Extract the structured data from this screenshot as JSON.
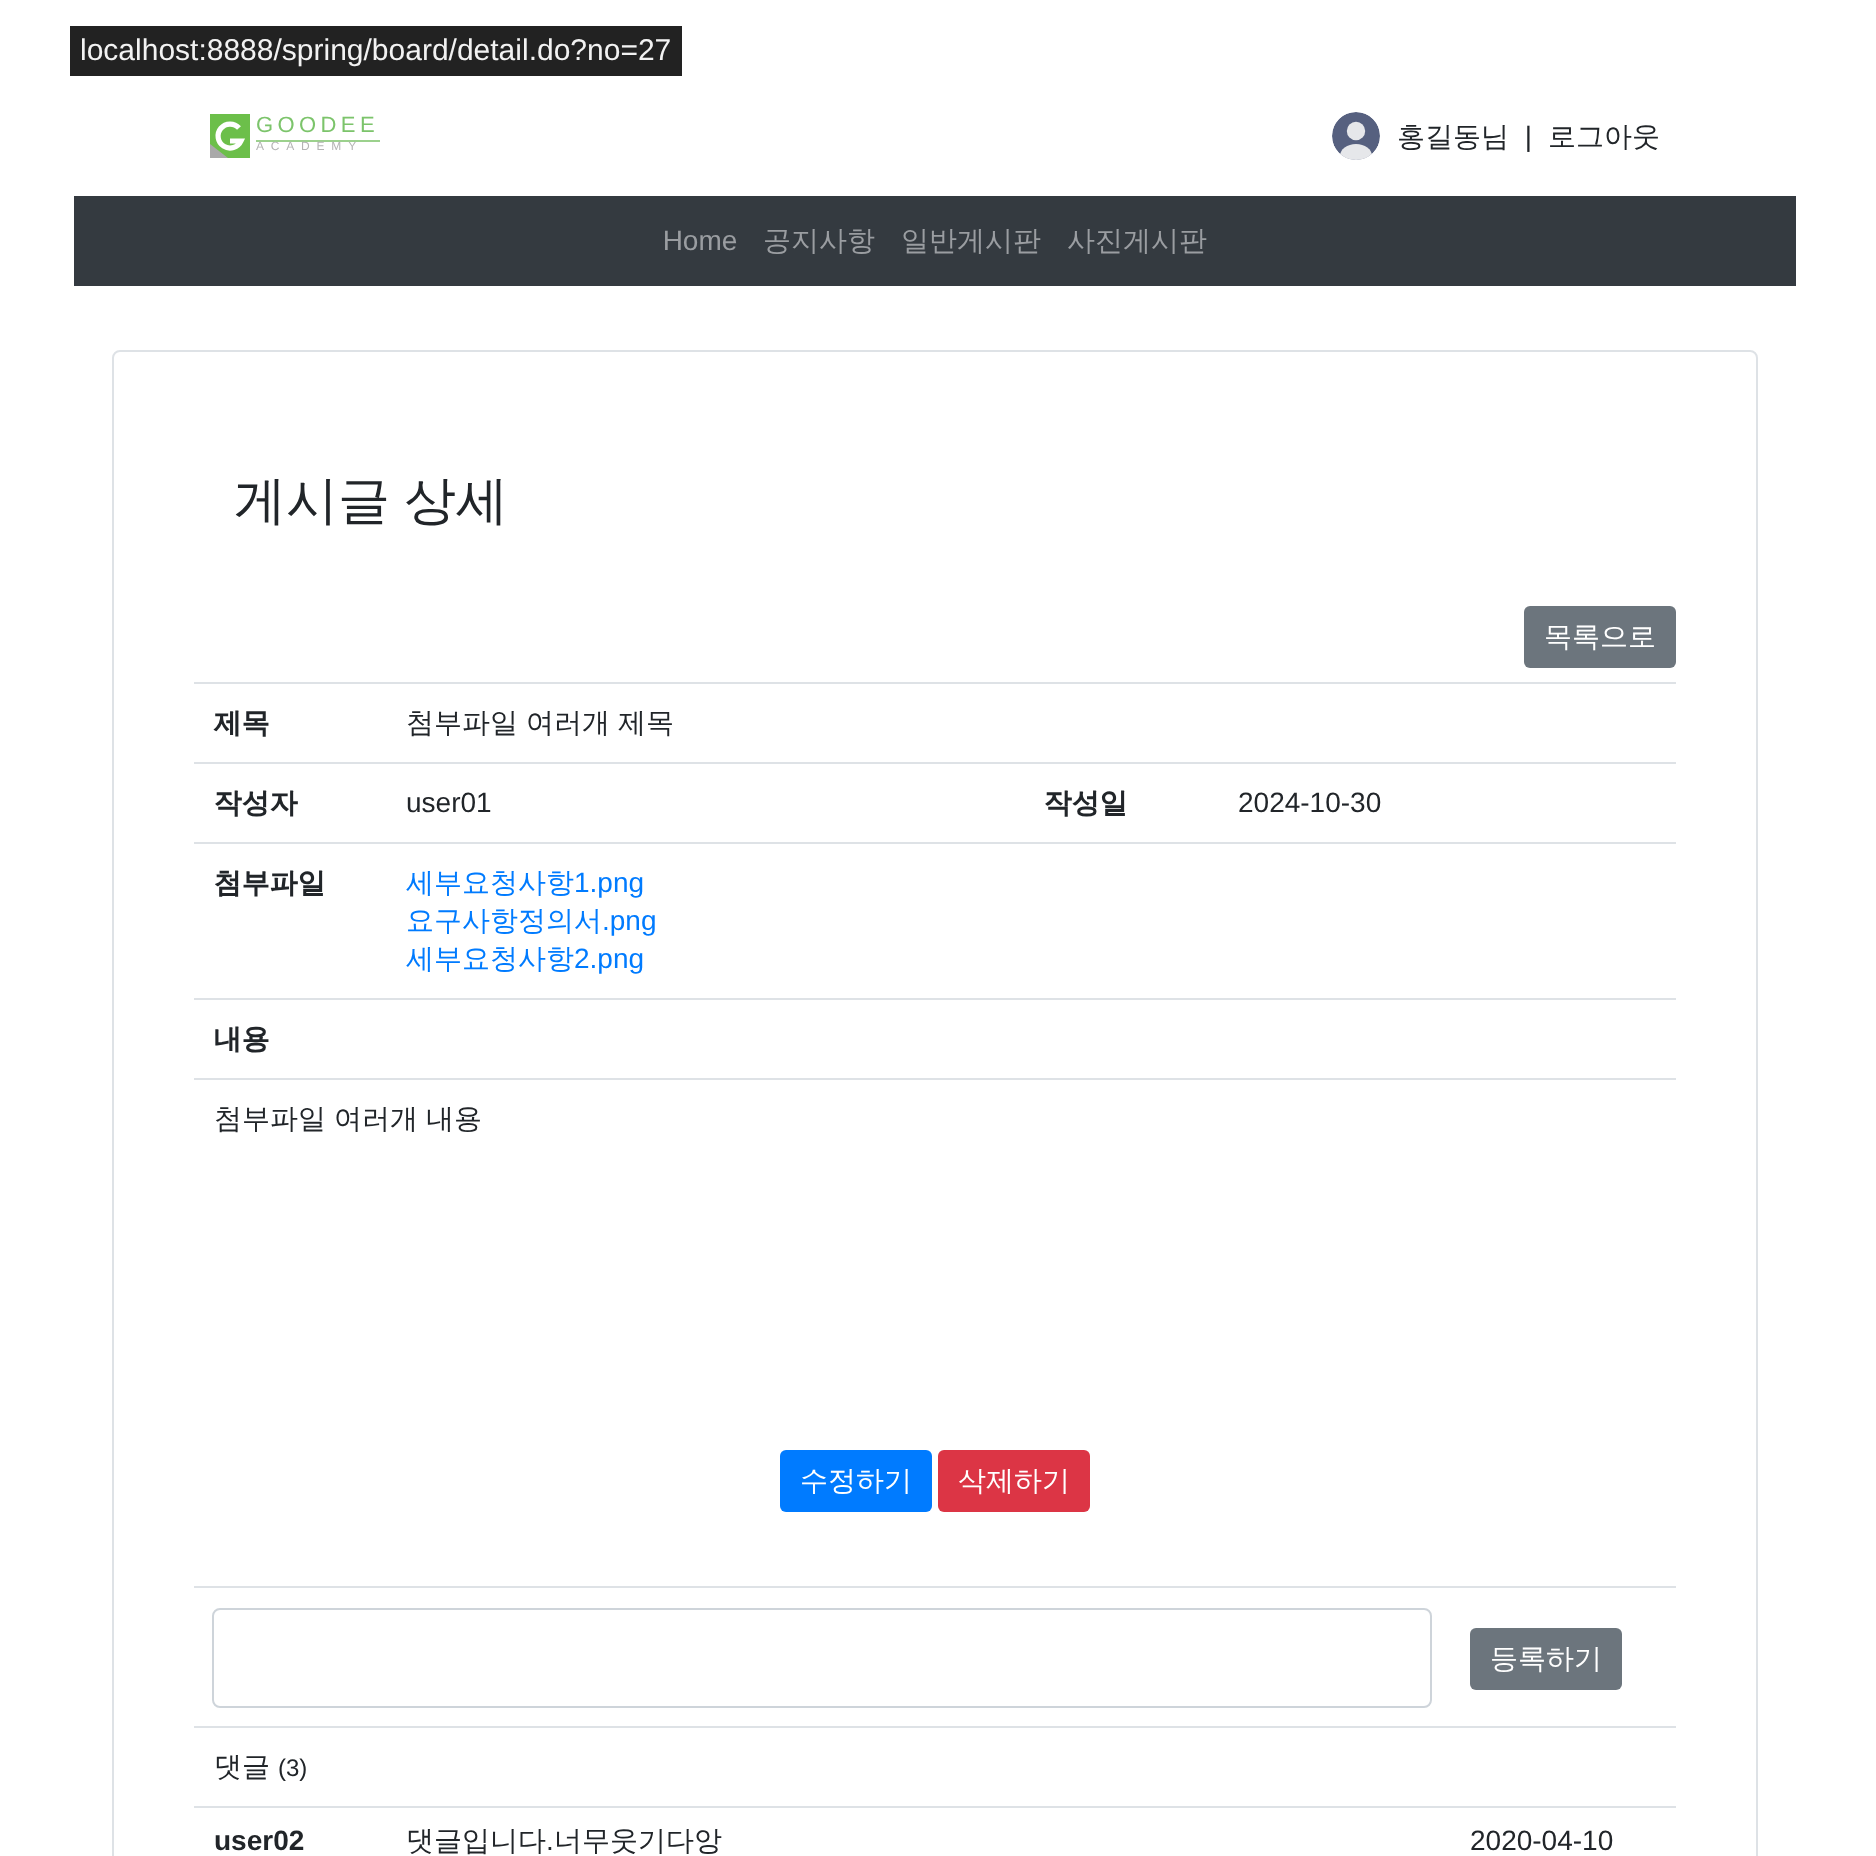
{
  "url_tooltip": {
    "text": "localhost:8888/spring/board/detail.do?no=27"
  },
  "header": {
    "logo": {
      "name": "GOODEE",
      "tagline": "ACADEMY"
    },
    "user": {
      "name": "홍길동님",
      "separator": "|",
      "logout": "로그아웃"
    }
  },
  "nav": {
    "items": [
      {
        "label": "Home"
      },
      {
        "label": "공지사항"
      },
      {
        "label": "일반게시판"
      },
      {
        "label": "사진게시판"
      }
    ]
  },
  "page": {
    "title": "게시글 상세",
    "list_button": "목록으로"
  },
  "post": {
    "title_label": "제목",
    "title": "첨부파일 여러개 제목",
    "writer_label": "작성자",
    "writer": "user01",
    "date_label": "작성일",
    "date": "2024-10-30",
    "attachments_label": "첨부파일",
    "attachments": [
      "세부요청사항1.png",
      "요구사항정의서.png",
      "세부요청사항2.png"
    ],
    "content_label": "내용",
    "content": "첨부파일 여러개 내용"
  },
  "actions": [
    {
      "kind": "edit",
      "label": "수정하기"
    },
    {
      "kind": "delete",
      "label": "삭제하기"
    }
  ],
  "comment_form": {
    "button": "등록하기"
  },
  "comments": {
    "label": "댓글",
    "count": "(3)",
    "items": [
      {
        "writer": "user02",
        "text": "댓글입니다.너무웃기다앙",
        "date": "2020-04-10"
      }
    ]
  }
}
